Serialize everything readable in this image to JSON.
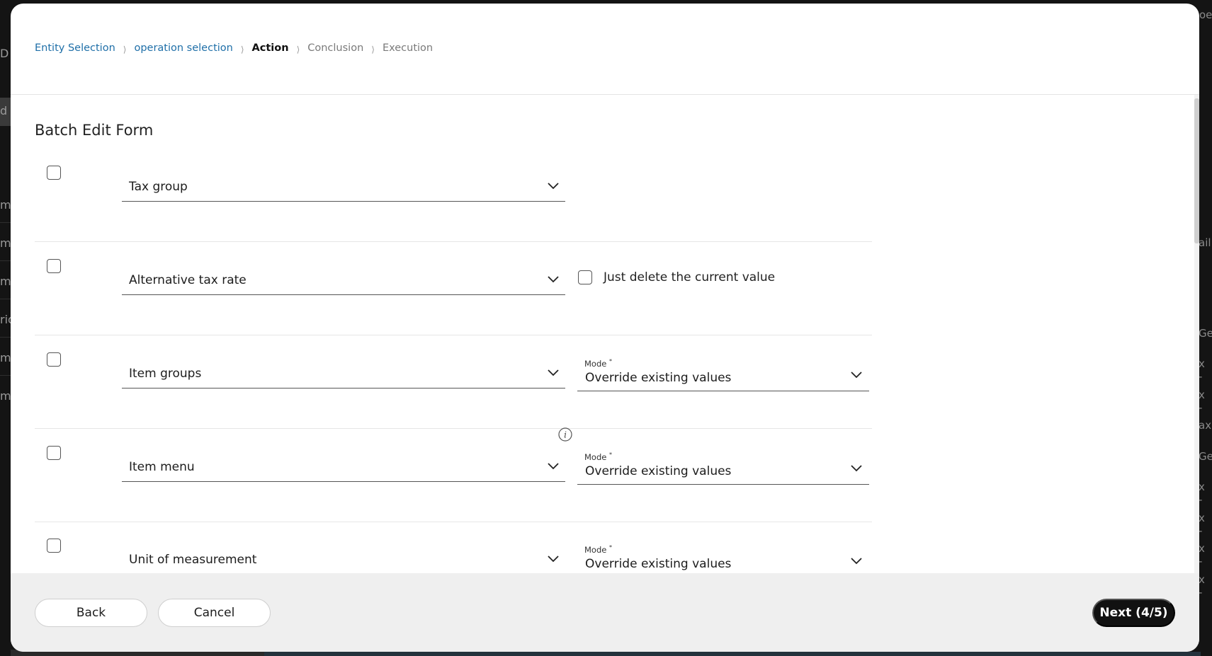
{
  "background": {
    "left_fragments": [
      "D",
      "d",
      "m",
      "m",
      "m",
      "ric",
      "m",
      "m"
    ],
    "right_fragments": [
      "ail",
      "Ge",
      "x -",
      "x -",
      "ax",
      "Ge",
      "x -",
      "x -",
      "x -",
      "x -"
    ],
    "top_right_fragment": "oe"
  },
  "breadcrumb": {
    "steps": [
      {
        "label": "Entity Selection",
        "state": "done"
      },
      {
        "label": "operation selection",
        "state": "done"
      },
      {
        "label": "Action",
        "state": "active"
      },
      {
        "label": "Conclusion",
        "state": "pending"
      },
      {
        "label": "Execution",
        "state": "pending"
      }
    ],
    "separator": "⟩"
  },
  "form": {
    "title": "Batch Edit Form",
    "rows": [
      {
        "field": "Tax group"
      },
      {
        "field": "Alternative tax rate",
        "option_label": "Just delete the current value"
      },
      {
        "field": "Item groups",
        "mode_label": "Mode",
        "mode_required": "*",
        "mode_value": "Override existing values"
      },
      {
        "field": "Item menu",
        "info_icon": "info-icon",
        "mode_label": "Mode",
        "mode_required": "*",
        "mode_value": "Override existing values"
      },
      {
        "field": "Unit of measurement",
        "mode_label": "Mode",
        "mode_required": "*",
        "mode_value": "Override existing values"
      }
    ]
  },
  "footer": {
    "back_label": "Back",
    "cancel_label": "Cancel",
    "next_label": "Next (4/5)"
  },
  "colors": {
    "link": "#1f6fa8",
    "primary_button": "#111111",
    "footer_bg": "#efefef",
    "backdrop": "#141414"
  }
}
